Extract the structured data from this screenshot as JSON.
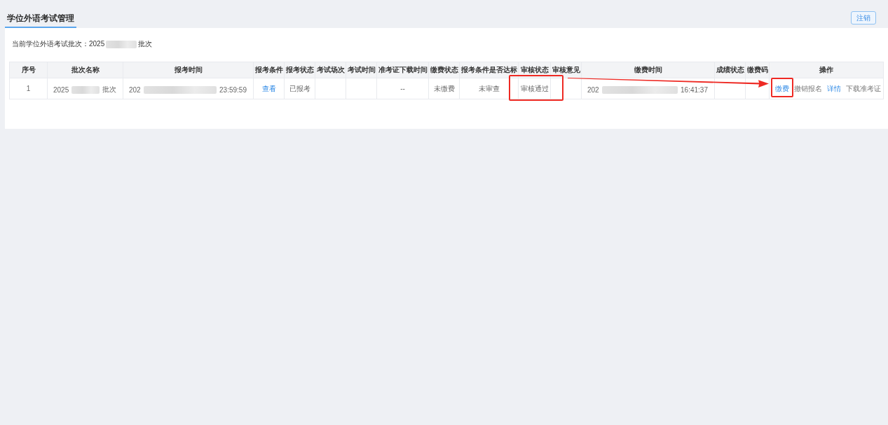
{
  "tabs": [
    {
      "label": "学位外语考试管理",
      "selected": true
    }
  ],
  "logout_button": {
    "label": "注销"
  },
  "current_batch": {
    "label": "当前学位外语考试批次：2025",
    "redacted": true,
    "suffix": "批次"
  },
  "table": {
    "columns": [
      "序号",
      "批次名称",
      "报考时间",
      "报考条件",
      "报考状态",
      "考试场次",
      "考试时间",
      "准考证下载时间",
      "缴费状态",
      "报考条件是否达标",
      "审核状态",
      "审核意见",
      "缴费时间",
      "成绩状态",
      "缴费码",
      "操作"
    ],
    "rows": [
      {
        "cells": [
          {
            "kind": "text",
            "text": "1",
            "highlighted": false
          },
          {
            "kind": "redacted",
            "prefix": "2025",
            "suffix": "批次",
            "highlighted": false
          },
          {
            "kind": "redacted",
            "prefix": "202",
            "suffix": "23:59:59",
            "highlighted": false
          },
          {
            "kind": "link",
            "text": "查看",
            "highlighted": false
          },
          {
            "kind": "text",
            "text": "已报考",
            "highlighted": false
          },
          {
            "kind": "empty",
            "highlighted": false
          },
          {
            "kind": "empty",
            "highlighted": false
          },
          {
            "kind": "text",
            "text": "--",
            "highlighted": false
          },
          {
            "kind": "text",
            "text": "未缴费",
            "highlighted": false
          },
          {
            "kind": "text",
            "text": "未审查",
            "highlighted": false
          },
          {
            "kind": "text",
            "text": "审核通过",
            "highlighted": true
          },
          {
            "kind": "empty",
            "highlighted": false
          },
          {
            "kind": "redacted",
            "prefix": "202",
            "suffix": "16:41:37",
            "highlighted": false
          },
          {
            "kind": "empty",
            "highlighted": false
          },
          {
            "kind": "empty",
            "highlighted": false
          },
          {
            "kind": "actions",
            "highlighted": false,
            "actions": [
              {
                "label": "缴费",
                "disabled": false,
                "highlighted": true
              },
              {
                "label": "撤销报名",
                "disabled": true,
                "highlighted": false
              },
              {
                "label": "详情",
                "disabled": false,
                "highlighted": false
              },
              {
                "label": "下载准考证",
                "disabled": true,
                "highlighted": false
              }
            ]
          }
        ]
      }
    ]
  },
  "annotations": [
    {
      "kind": "arrow"
    }
  ]
}
